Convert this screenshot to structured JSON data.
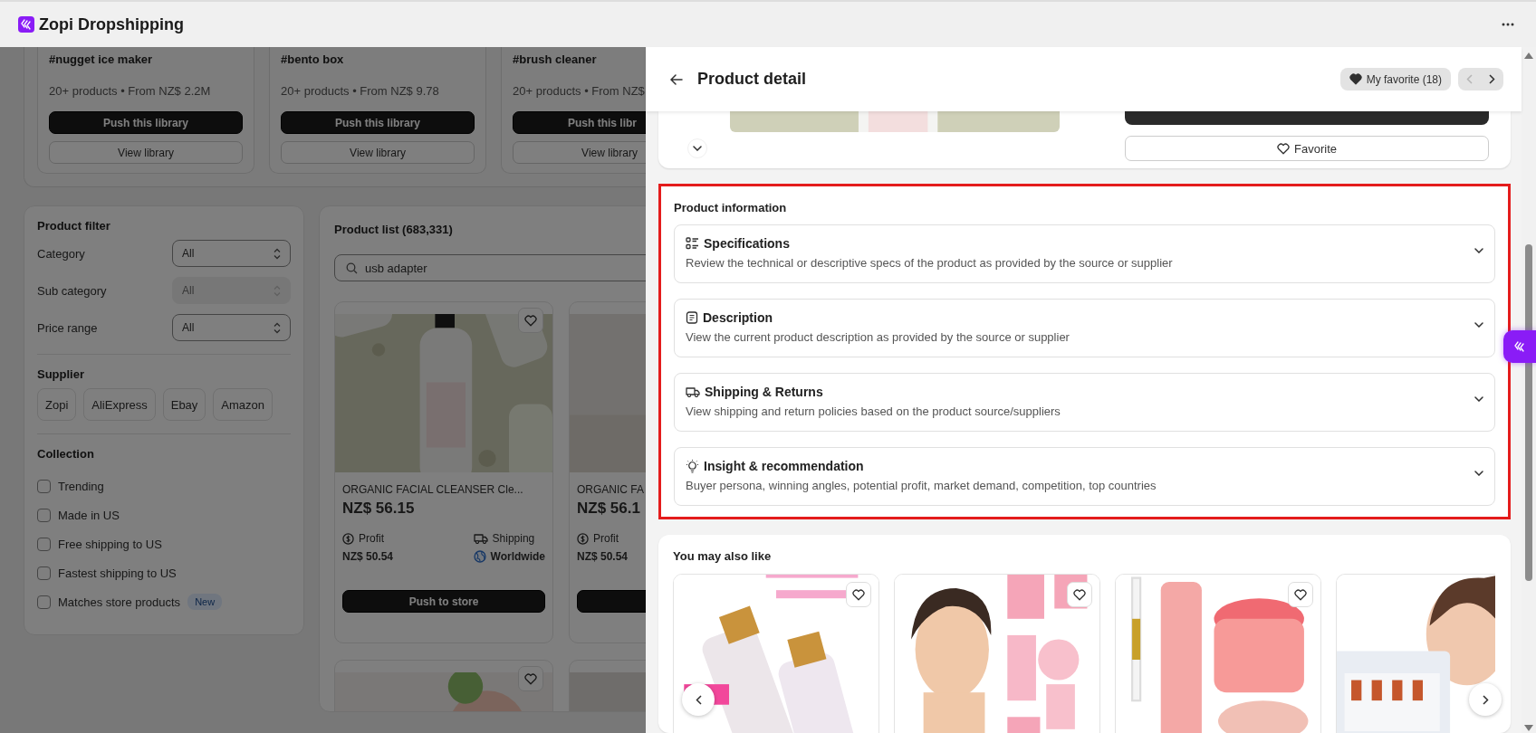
{
  "app": {
    "title": "Zopi Dropshipping"
  },
  "libraries": [
    {
      "tag": "#nugget ice maker",
      "summary": "20+ products • From NZ$ 2.2M",
      "push": "Push this library",
      "view": "View library"
    },
    {
      "tag": "#bento box",
      "summary": "20+ products • From NZ$ 9.78",
      "push": "Push this library",
      "view": "View library"
    },
    {
      "tag": "#brush cleaner",
      "summary": "20+ products • From NZ$",
      "push": "Push this libr",
      "view": "View library"
    }
  ],
  "filter": {
    "title": "Product filter",
    "fields": [
      {
        "label": "Category",
        "value": "All",
        "disabled": false
      },
      {
        "label": "Sub category",
        "value": "All",
        "disabled": true
      },
      {
        "label": "Price range",
        "value": "All",
        "disabled": false
      }
    ],
    "supplier_title": "Supplier",
    "suppliers": [
      "Zopi",
      "AliExpress",
      "Ebay",
      "Amazon"
    ],
    "collection_title": "Collection",
    "collection": [
      {
        "label": "Trending",
        "checked": false
      },
      {
        "label": "Made in US",
        "checked": false
      },
      {
        "label": "Free shipping to US",
        "checked": false
      },
      {
        "label": "Fastest shipping to US",
        "checked": false
      },
      {
        "label": "Matches store products",
        "checked": false,
        "badge": "New"
      }
    ]
  },
  "product_list": {
    "title": "Product list (683,331)",
    "search": {
      "value": "usb adapter"
    },
    "products": [
      {
        "name": "ORGANIC FACIAL CLEANSER Cle...",
        "price": "NZ$ 56.15",
        "profit_label": "Profit",
        "profit": "NZ$ 50.54",
        "shipping_label": "Shipping",
        "shipping": "Worldwide",
        "button": "Push to store",
        "favorite": false
      },
      {
        "name": "ORGANIC FA",
        "price": "NZ$ 56.1",
        "profit_label": "Profit",
        "profit": "NZ$ 50.54"
      },
      {
        "favorite": false
      },
      {
        "kind": "picture"
      }
    ]
  },
  "detail": {
    "title": "Product detail",
    "my_favorite": "My favorite (18)",
    "nav": [
      {
        "kind": "prev",
        "disabled": true
      },
      {
        "kind": "next",
        "disabled": false
      }
    ],
    "favorite_button": "Favorite",
    "info": {
      "title": "Product information",
      "items": [
        {
          "title": "Specifications",
          "text": "Review the technical or descriptive specs of the product as provided by the source or supplier",
          "expanded": false
        },
        {
          "title": "Description",
          "text": "View the current product description as provided by the source or supplier",
          "expanded": false
        },
        {
          "title": "Shipping & Returns",
          "text": "View shipping and return policies based on the product source/suppliers",
          "expanded": false
        },
        {
          "title": "Insight & recommendation",
          "text": "Buyer persona, winning angles, potential profit, market demand, competition, top countries",
          "expanded": false
        }
      ]
    },
    "related": {
      "title": "You may also like",
      "items": [
        {
          "kind": "picture",
          "favorite": false
        },
        {
          "kind": "picture",
          "favorite": false
        },
        {
          "kind": "picture",
          "favorite": false
        },
        {
          "kind": "picture"
        }
      ]
    }
  }
}
